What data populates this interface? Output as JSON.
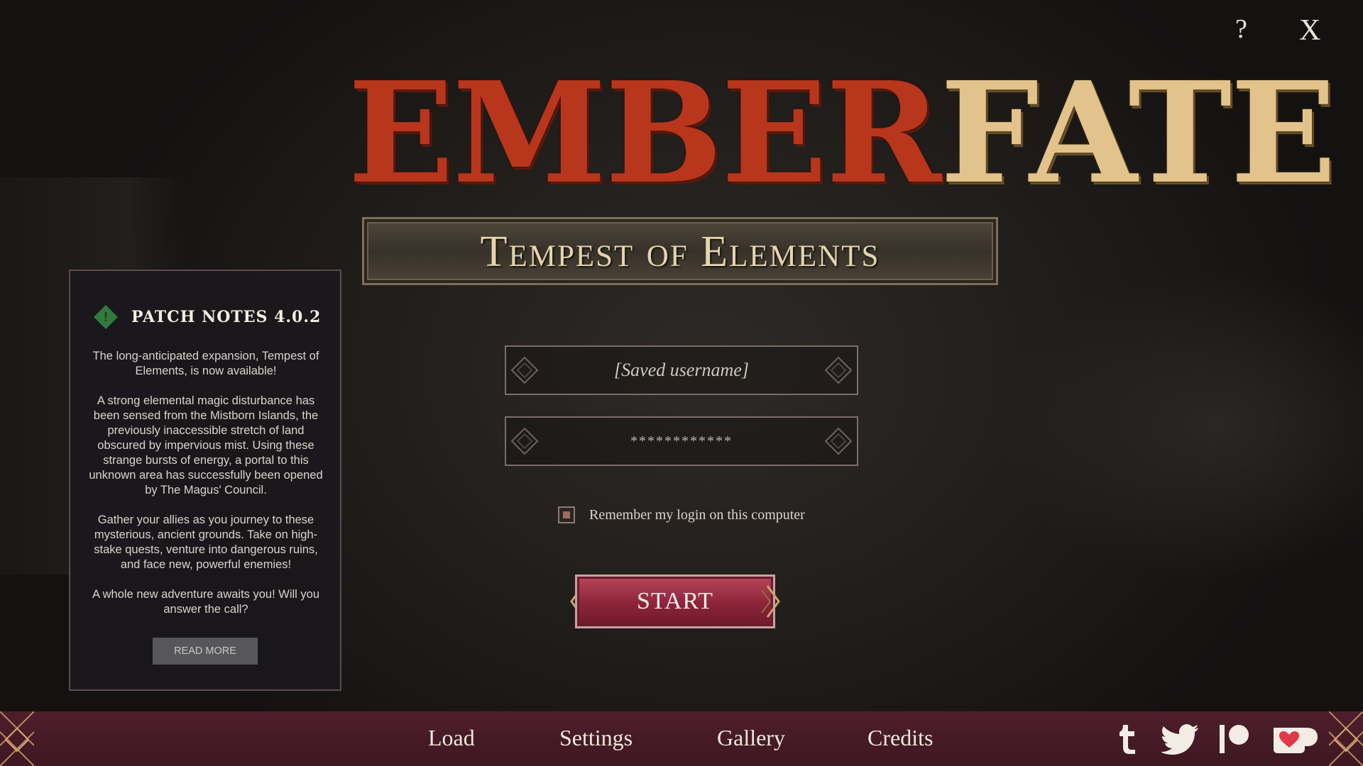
{
  "window": {
    "help_label": "?",
    "close_label": "X"
  },
  "logo": {
    "part1": "EMBER",
    "part2": "FATE",
    "subtitle": "Tempest of Elements"
  },
  "patch_notes": {
    "title": "PATCH NOTES 4.0.2",
    "paragraphs": [
      "The long-anticipated expansion, Tempest of Elements, is now available!",
      "A strong elemental magic disturbance has been sensed from the Mistborn Islands, the previously inaccessible stretch of land obscured by impervious mist. Using these strange bursts of energy, a portal to this unknown area has successfully been opened by The Magus' Council.",
      "Gather your allies as you journey to these mysterious, ancient grounds. Take on high-stake quests, venture into dangerous ruins, and face new, powerful enemies!",
      "A whole new adventure awaits you! Will you answer the call?"
    ],
    "read_more_label": "READ MORE"
  },
  "login": {
    "username_value": "[Saved username]",
    "password_value": "************",
    "remember_label": "Remember my login on this computer",
    "remember_checked": true,
    "start_label": "START"
  },
  "nav": {
    "items": [
      "Load",
      "Settings",
      "Gallery",
      "Credits"
    ]
  },
  "social": {
    "icons": [
      "tumblr-icon",
      "twitter-icon",
      "patreon-icon",
      "kofi-icon"
    ]
  },
  "colors": {
    "accent": "#8c2438",
    "bar": "#4e1e2b",
    "ember": "#b8361c",
    "fate": "#e2c38b",
    "notes_icon": "#2f7a3c"
  }
}
